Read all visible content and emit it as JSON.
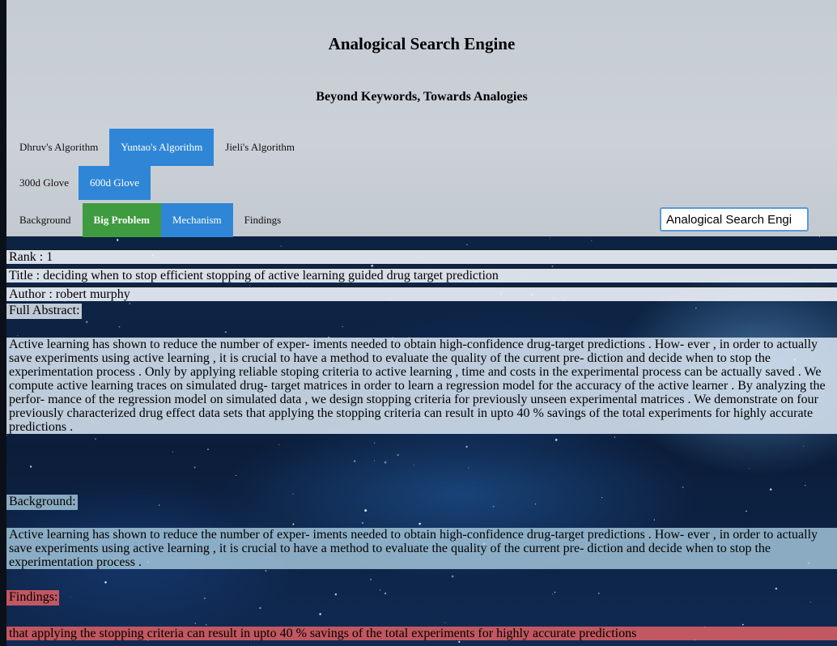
{
  "header": {
    "title": "Analogical Search Engine",
    "subtitle": "Beyond Keywords, Towards Analogies"
  },
  "algorithms": [
    {
      "label": "Dhruv's Algorithm",
      "active": false
    },
    {
      "label": "Yuntao's Algorithm",
      "active": true
    },
    {
      "label": "Jieli's Algorithm",
      "active": false
    }
  ],
  "embeddings": [
    {
      "label": "300d Glove",
      "active": false
    },
    {
      "label": "600d Glove",
      "active": true
    }
  ],
  "facets": [
    {
      "label": "Background",
      "active": false
    },
    {
      "label": "Big Problem",
      "active": true,
      "color": "#3f9b3f"
    },
    {
      "label": "Mechanism",
      "active": true,
      "color": "#2f86d6"
    },
    {
      "label": "Findings",
      "active": false
    }
  ],
  "search": {
    "value": "Analogical Search Engi"
  },
  "result": {
    "rank": "Rank : 1",
    "title": "Title : deciding when to stop efficient stopping of active learning guided drug target prediction",
    "author": "Author : robert murphy",
    "full_abstract_label": "Full Abstract:",
    "full_abstract": "Active learning has shown to reduce the number of exper- iments needed to obtain high-confidence drug-target predictions . How- ever , in order to actually save experiments using active learning , it is crucial to have a method to evaluate the quality of the current pre- diction and decide when to stop the experimentation process . Only by applying reliable stoping criteria to active learning , time and costs in the experimental process can be actually saved . We compute active learning traces on simulated drug- target matrices in order to learn a regression model for the accuracy of the active learner . By analyzing the perfor- mance of the regression model on simulated data , we design stopping criteria for previously unseen experimental matrices . We demonstrate on four previously characterized drug effect data sets that applying the stopping criteria can result in upto 40 % savings of the total experiments for highly accurate predictions .",
    "background_label": "Background:",
    "background": "Active learning has shown to reduce the number of exper- iments needed to obtain high-confidence drug-target predictions . How- ever , in order to actually save experiments using active learning , it is crucial to have a method to evaluate the quality of the current pre- diction and decide when to stop the experimentation process .",
    "findings_label": "Findings:",
    "findings": "that applying the stopping criteria can result in upto 40 % savings of the total experiments for highly accurate predictions"
  },
  "colors": {
    "accent_blue": "#2f86d6",
    "accent_green": "#3f9b3f",
    "findings_red": "#e15f64",
    "header_gray": "#c9cfd6"
  }
}
